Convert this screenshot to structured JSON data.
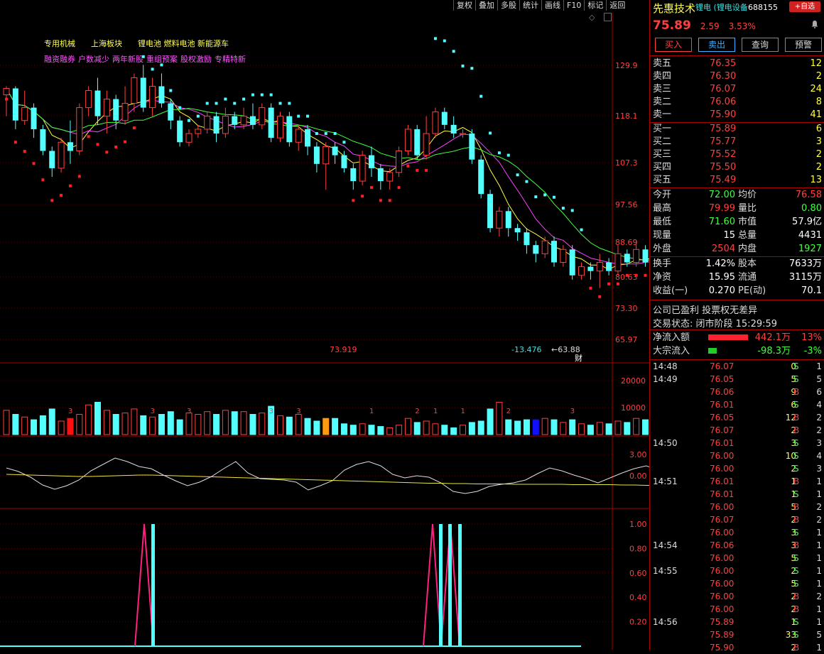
{
  "toolbar": [
    "复权",
    "叠加",
    "多股",
    "统计",
    "画线",
    "F10",
    "标记",
    "返回"
  ],
  "tags_row1": [
    "专用机械",
    "上海板块",
    "锂电池 燃料电池 新能源车"
  ],
  "tags_row2": [
    "融资融券",
    "户数减少",
    "两年新股",
    "重组预案",
    "股权激励",
    "专精特新"
  ],
  "main_axis": {
    "labels": [
      "129.9",
      "118.1",
      "107.3",
      "97.56",
      "88.69",
      "80.63",
      "73.30",
      "65.97"
    ],
    "min": 65.97,
    "max": 129.9
  },
  "main_annotations": {
    "low_marker": "73.919",
    "bottom_value": "-13.476",
    "arrow_value": "←63.88",
    "badge": "财"
  },
  "volume_axis": {
    "labels": [
      "20000",
      "10000"
    ]
  },
  "osc_axis": {
    "labels": [
      "3.00",
      "0.00"
    ]
  },
  "signal_axis": {
    "labels": [
      "1.00",
      "0.80",
      "0.60",
      "0.40",
      "0.20"
    ]
  },
  "colors": {
    "up": "#ff4040",
    "down": "#54ffff",
    "ma1": "#ffff40",
    "ma2": "#ff40ff",
    "ma3": "#40ff40",
    "dots": "#54ffff",
    "dots_red": "#ff2020"
  },
  "candles": [
    {
      "o": 123,
      "c": 124.5,
      "h": 125,
      "l": 118
    },
    {
      "o": 124.5,
      "c": 117,
      "h": 125,
      "l": 115
    },
    {
      "o": 117,
      "c": 120,
      "h": 124,
      "l": 116
    },
    {
      "o": 120,
      "c": 115,
      "h": 121,
      "l": 113
    },
    {
      "o": 115,
      "c": 110,
      "h": 116,
      "l": 109
    },
    {
      "o": 110,
      "c": 106,
      "h": 111,
      "l": 104
    },
    {
      "o": 106,
      "c": 112,
      "h": 113,
      "l": 105
    },
    {
      "o": 112,
      "c": 110,
      "h": 117,
      "l": 107
    },
    {
      "o": 110,
      "c": 120,
      "h": 121,
      "l": 109
    },
    {
      "o": 120,
      "c": 124,
      "h": 125,
      "l": 118
    },
    {
      "o": 124,
      "c": 118,
      "h": 127,
      "l": 116
    },
    {
      "o": 118,
      "c": 122,
      "h": 124,
      "l": 114
    },
    {
      "o": 122,
      "c": 117,
      "h": 123,
      "l": 115
    },
    {
      "o": 117,
      "c": 121,
      "h": 125,
      "l": 116
    },
    {
      "o": 121,
      "c": 127,
      "h": 128,
      "l": 119
    },
    {
      "o": 127,
      "c": 120,
      "h": 130,
      "l": 119
    },
    {
      "o": 120,
      "c": 125,
      "h": 127,
      "l": 118
    },
    {
      "o": 125,
      "c": 121,
      "h": 128,
      "l": 120
    },
    {
      "o": 121,
      "c": 117,
      "h": 122,
      "l": 115
    },
    {
      "o": 117,
      "c": 112,
      "h": 118,
      "l": 111
    },
    {
      "o": 112,
      "c": 114,
      "h": 115,
      "l": 111
    },
    {
      "o": 114,
      "c": 115,
      "h": 116,
      "l": 113
    },
    {
      "o": 115,
      "c": 118,
      "h": 119,
      "l": 114
    },
    {
      "o": 118,
      "c": 114,
      "h": 119,
      "l": 112
    },
    {
      "o": 114,
      "c": 118,
      "h": 120,
      "l": 113
    },
    {
      "o": 118,
      "c": 116,
      "h": 119,
      "l": 115
    },
    {
      "o": 116,
      "c": 118,
      "h": 120,
      "l": 115
    },
    {
      "o": 118,
      "c": 116,
      "h": 121,
      "l": 115
    },
    {
      "o": 116,
      "c": 120,
      "h": 121,
      "l": 115
    },
    {
      "o": 120,
      "c": 113,
      "h": 121,
      "l": 112
    },
    {
      "o": 113,
      "c": 118,
      "h": 119,
      "l": 112
    },
    {
      "o": 118,
      "c": 112,
      "h": 119,
      "l": 111
    },
    {
      "o": 112,
      "c": 115,
      "h": 116,
      "l": 110
    },
    {
      "o": 115,
      "c": 111,
      "h": 116,
      "l": 109
    },
    {
      "o": 111,
      "c": 107,
      "h": 112,
      "l": 105
    },
    {
      "o": 107,
      "c": 111,
      "h": 112,
      "l": 101
    },
    {
      "o": 111,
      "c": 109,
      "h": 112,
      "l": 107
    },
    {
      "o": 109,
      "c": 106,
      "h": 110,
      "l": 105
    },
    {
      "o": 106,
      "c": 103,
      "h": 107,
      "l": 101
    },
    {
      "o": 103,
      "c": 109,
      "h": 110,
      "l": 102
    },
    {
      "o": 109,
      "c": 106,
      "h": 111,
      "l": 104
    },
    {
      "o": 106,
      "c": 103,
      "h": 107,
      "l": 101
    },
    {
      "o": 103,
      "c": 105,
      "h": 106,
      "l": 101
    },
    {
      "o": 105,
      "c": 110,
      "h": 111,
      "l": 104
    },
    {
      "o": 110,
      "c": 115,
      "h": 116,
      "l": 109
    },
    {
      "o": 115,
      "c": 109,
      "h": 116,
      "l": 108
    },
    {
      "o": 109,
      "c": 114,
      "h": 118,
      "l": 108
    },
    {
      "o": 114,
      "c": 119,
      "h": 120,
      "l": 113
    },
    {
      "o": 119,
      "c": 116,
      "h": 120,
      "l": 115
    },
    {
      "o": 116,
      "c": 114,
      "h": 118,
      "l": 113
    },
    {
      "o": 114,
      "c": 114,
      "h": 115,
      "l": 113
    },
    {
      "o": 114,
      "c": 108,
      "h": 115,
      "l": 107
    },
    {
      "o": 108,
      "c": 100,
      "h": 109,
      "l": 99
    },
    {
      "o": 100,
      "c": 92,
      "h": 101,
      "l": 91
    },
    {
      "o": 92,
      "c": 96,
      "h": 97,
      "l": 90
    },
    {
      "o": 96,
      "c": 92,
      "h": 97,
      "l": 90
    },
    {
      "o": 92,
      "c": 91,
      "h": 93,
      "l": 89
    },
    {
      "o": 91,
      "c": 88,
      "h": 92,
      "l": 86
    },
    {
      "o": 88,
      "c": 86,
      "h": 89,
      "l": 84
    },
    {
      "o": 86,
      "c": 89,
      "h": 90,
      "l": 85
    },
    {
      "o": 89,
      "c": 84,
      "h": 90,
      "l": 83
    },
    {
      "o": 84,
      "c": 87,
      "h": 88,
      "l": 83
    },
    {
      "o": 87,
      "c": 81,
      "h": 88,
      "l": 80
    },
    {
      "o": 81,
      "c": 83,
      "h": 84,
      "l": 80
    },
    {
      "o": 83,
      "c": 82,
      "h": 84,
      "l": 80
    },
    {
      "o": 82,
      "c": 84,
      "h": 86,
      "l": 78
    },
    {
      "o": 84,
      "c": 82,
      "h": 85,
      "l": 81
    },
    {
      "o": 82,
      "c": 86,
      "h": 88,
      "l": 81
    },
    {
      "o": 86,
      "c": 84,
      "h": 87,
      "l": 83
    },
    {
      "o": 84,
      "c": 87,
      "h": 89,
      "l": 83
    },
    {
      "o": 87,
      "c": 84,
      "h": 88,
      "l": 83
    },
    {
      "o": 84,
      "c": 85,
      "h": 87,
      "l": 83
    },
    {
      "o": 85,
      "c": 83,
      "h": 87,
      "l": 82
    },
    {
      "o": 83,
      "c": 86,
      "h": 87,
      "l": 82
    },
    {
      "o": 86,
      "c": 85,
      "h": 87,
      "l": 84
    },
    {
      "o": 85,
      "c": 80,
      "h": 86,
      "l": 78
    },
    {
      "o": 80,
      "c": 72,
      "h": 81,
      "l": 71
    },
    {
      "o": 72,
      "c": 69,
      "h": 73,
      "l": 67
    },
    {
      "o": 69,
      "c": 67,
      "h": 72,
      "l": 66
    },
    {
      "o": 67,
      "c": 72,
      "h": 73,
      "l": 66
    },
    {
      "o": 72,
      "c": 71,
      "h": 73,
      "l": 70
    },
    {
      "o": 71,
      "c": 72,
      "h": 73,
      "l": 70
    },
    {
      "o": 72,
      "c": 75.89,
      "h": 79.99,
      "l": 71.6
    }
  ],
  "volumes": [
    9000,
    7500,
    6500,
    5500,
    7000,
    9500,
    5000,
    6000,
    7500,
    11000,
    12000,
    9000,
    7500,
    8000,
    9500,
    7000,
    6500,
    7500,
    8500,
    5500,
    8000,
    7500,
    8500,
    7500,
    9000,
    8500,
    8500,
    7500,
    8000,
    10500,
    7000,
    6500,
    7500,
    6000,
    5000,
    6000,
    6000,
    4000,
    3500,
    4000,
    3500,
    3000,
    2500,
    3500,
    6000,
    4500,
    5000,
    4000,
    3500,
    2500,
    3500,
    4500,
    5000,
    9500,
    12000,
    5500,
    5000,
    5500,
    5500,
    6000,
    5500,
    4500,
    5500,
    4000,
    3500,
    4500,
    4000,
    5000,
    4500,
    6000,
    5500,
    4000,
    4000,
    3500,
    4500,
    4500,
    7500,
    4000,
    5000,
    7000,
    5500,
    4000,
    4500
  ],
  "volume_labels": [
    {
      "i": 5,
      "t": "3"
    },
    {
      "i": 12,
      "t": "3"
    },
    {
      "i": 15,
      "t": "3"
    },
    {
      "i": 22,
      "t": "3"
    },
    {
      "i": 24,
      "t": "3"
    },
    {
      "i": 30,
      "t": "1"
    },
    {
      "i": 34,
      "t": "2"
    },
    {
      "i": 36,
      "t": "1"
    },
    {
      "i": 38,
      "t": "1"
    },
    {
      "i": 42,
      "t": "2"
    },
    {
      "i": 47,
      "t": "3"
    },
    {
      "i": 56,
      "t": "1"
    },
    {
      "i": 60,
      "t": "3"
    },
    {
      "i": 62,
      "t": "3"
    }
  ],
  "osc_line": [
    1.1,
    0.6,
    -0.2,
    -1.3,
    -1.9,
    -1.4,
    -0.6,
    0.7,
    1.6,
    2.5,
    2.0,
    1.3,
    1.0,
    0.1,
    -0.7,
    -1.4,
    -0.9,
    -0.1,
    1.0,
    2.0,
    0.4,
    -0.4,
    -0.5,
    -0.6,
    -0.9,
    -2.0,
    -1.4,
    -0.7,
    0.8,
    1.6,
    2.0,
    1.4,
    0.2,
    -0.3,
    0.0,
    -0.2,
    -1.0,
    -2.2,
    -2.5,
    -2.2,
    -1.5,
    -1.2,
    -1.0,
    -0.6,
    0.3,
    1.1,
    0.7,
    0.1,
    -0.4,
    -1.0,
    -0.3,
    0.4,
    1.0,
    1.4,
    0.8,
    -0.8,
    -2.0,
    -2.8,
    -2.4,
    -1.6,
    -0.2,
    1.5,
    1.5
  ],
  "osc_ma": [
    0.2,
    0.15,
    0.1,
    0.05,
    0.0,
    -0.05,
    -0.1,
    -0.1,
    -0.05,
    0.0,
    0.05,
    0.1,
    0.1,
    0.05,
    0.0,
    -0.05,
    -0.1,
    -0.15,
    -0.2,
    -0.25,
    -0.3,
    -0.35,
    -0.4,
    -0.45,
    -0.5,
    -0.55,
    -0.6,
    -0.65,
    -0.7,
    -0.75,
    -0.8,
    -0.85,
    -0.9,
    -0.95,
    -1.0,
    -1.05,
    -1.05,
    -1.1,
    -1.1,
    -1.15,
    -1.15,
    -1.15,
    -1.2,
    -1.2,
    -1.2,
    -1.2,
    -1.2,
    -1.25,
    -1.25,
    -1.25,
    -1.25,
    -1.3,
    -1.3,
    -1.35,
    -1.35,
    -1.4,
    -1.4,
    -1.45,
    -1.45,
    -1.5,
    -1.5,
    -1.45,
    -1.4
  ],
  "signal_spikes": [
    14,
    15,
    44,
    45,
    46,
    47,
    48
  ],
  "stock": {
    "name": "先惠技术",
    "sector": "锂电 (锂电设备",
    "code": "688155",
    "watch_button": "+自选",
    "price": "75.89",
    "change": "2.59",
    "pct": "3.53%"
  },
  "trade_buttons": [
    "买入",
    "卖出",
    "查询",
    "预警"
  ],
  "asks": [
    {
      "label": "卖五",
      "price": "76.35",
      "vol": "12"
    },
    {
      "label": "卖四",
      "price": "76.30",
      "vol": "2"
    },
    {
      "label": "卖三",
      "price": "76.07",
      "vol": "24"
    },
    {
      "label": "卖二",
      "price": "76.06",
      "vol": "8"
    },
    {
      "label": "卖一",
      "price": "75.90",
      "vol": "41"
    }
  ],
  "bids": [
    {
      "label": "买一",
      "price": "75.89",
      "vol": "6"
    },
    {
      "label": "买二",
      "price": "75.77",
      "vol": "3"
    },
    {
      "label": "买三",
      "price": "75.52",
      "vol": "2"
    },
    {
      "label": "买四",
      "price": "75.50",
      "vol": "2"
    },
    {
      "label": "买五",
      "price": "75.49",
      "vol": "13"
    }
  ],
  "stats1": [
    {
      "l1": "今开",
      "v1": "72.00",
      "c1": "green",
      "l2": "均价",
      "v2": "76.58",
      "c2": "red"
    },
    {
      "l1": "最高",
      "v1": "79.99",
      "c1": "red",
      "l2": "量比",
      "v2": "0.80",
      "c2": "green"
    },
    {
      "l1": "最低",
      "v1": "71.60",
      "c1": "green",
      "l2": "市值",
      "v2": "57.9亿",
      "c2": "white"
    },
    {
      "l1": "现量",
      "v1": "15",
      "c1": "white",
      "l2": "总量",
      "v2": "4431",
      "c2": "white"
    },
    {
      "l1": "外盘",
      "v1": "2504",
      "c1": "red",
      "l2": "内盘",
      "v2": "1927",
      "c2": "green"
    }
  ],
  "stats2": [
    {
      "l1": "换手",
      "v1": "1.42%",
      "c1": "white",
      "l2": "股本",
      "v2": "7633万",
      "c2": "white"
    },
    {
      "l1": "净资",
      "v1": "15.95",
      "c1": "white",
      "l2": "流通",
      "v2": "3115万",
      "c2": "white"
    },
    {
      "l1": "收益(一)",
      "v1": "0.270",
      "c1": "white",
      "l2": "PE(动)",
      "v2": "70.1",
      "c2": "white"
    }
  ],
  "info": {
    "note": "公司已盈利 投票权无差异",
    "status": "交易状态: 闭市阶段 15:29:59"
  },
  "flows": [
    {
      "label": "净流入额",
      "val": "442.1万",
      "pct": "13%",
      "color": "red",
      "bar": 1.0
    },
    {
      "label": "大宗流入",
      "val": "-98.3万",
      "pct": "-3%",
      "color": "green",
      "bar": 0.22
    }
  ],
  "ticks": [
    {
      "t": "14:48",
      "p": "76.07",
      "v": "0",
      "bs": "S",
      "n": "1"
    },
    {
      "t": "14:49",
      "p": "76.05",
      "v": "5",
      "bs": "S",
      "n": "5"
    },
    {
      "t": "",
      "p": "76.06",
      "v": "9",
      "bs": "B",
      "n": "6"
    },
    {
      "t": "",
      "p": "76.01",
      "v": "6",
      "bs": "S",
      "n": "4"
    },
    {
      "t": "",
      "p": "76.05",
      "v": "12",
      "bs": "B",
      "n": "2"
    },
    {
      "t": "",
      "p": "76.07",
      "v": "2",
      "bs": "B",
      "n": "2"
    },
    {
      "t": "14:50",
      "p": "76.01",
      "v": "3",
      "bs": "S",
      "n": "3"
    },
    {
      "t": "",
      "p": "76.00",
      "v": "10",
      "bs": "S",
      "n": "4"
    },
    {
      "t": "",
      "p": "76.00",
      "v": "2",
      "bs": "S",
      "n": "3"
    },
    {
      "t": "14:51",
      "p": "76.01",
      "v": "1",
      "bs": "B",
      "n": "1"
    },
    {
      "t": "",
      "p": "76.01",
      "v": "1",
      "bs": "S",
      "n": "1"
    },
    {
      "t": "",
      "p": "76.00",
      "v": "5",
      "bs": "B",
      "n": "2"
    },
    {
      "t": "",
      "p": "76.07",
      "v": "2",
      "bs": "B",
      "n": "2"
    },
    {
      "t": "",
      "p": "76.00",
      "v": "3",
      "bs": "S",
      "n": "1"
    },
    {
      "t": "14:54",
      "p": "76.06",
      "v": "3",
      "bs": "B",
      "n": "1"
    },
    {
      "t": "",
      "p": "76.00",
      "v": "5",
      "bs": "S",
      "n": "1"
    },
    {
      "t": "14:55",
      "p": "76.00",
      "v": "2",
      "bs": "S",
      "n": "1"
    },
    {
      "t": "",
      "p": "76.00",
      "v": "5",
      "bs": "S",
      "n": "1"
    },
    {
      "t": "",
      "p": "76.00",
      "v": "2",
      "bs": "B",
      "n": "2"
    },
    {
      "t": "",
      "p": "76.00",
      "v": "2",
      "bs": "B",
      "n": "1"
    },
    {
      "t": "14:56",
      "p": "75.89",
      "v": "1",
      "bs": "S",
      "n": "1"
    },
    {
      "t": "",
      "p": "75.89",
      "v": "33",
      "bs": "S",
      "n": "5"
    },
    {
      "t": "",
      "p": "75.90",
      "v": "2",
      "bs": "B",
      "n": "1"
    }
  ]
}
